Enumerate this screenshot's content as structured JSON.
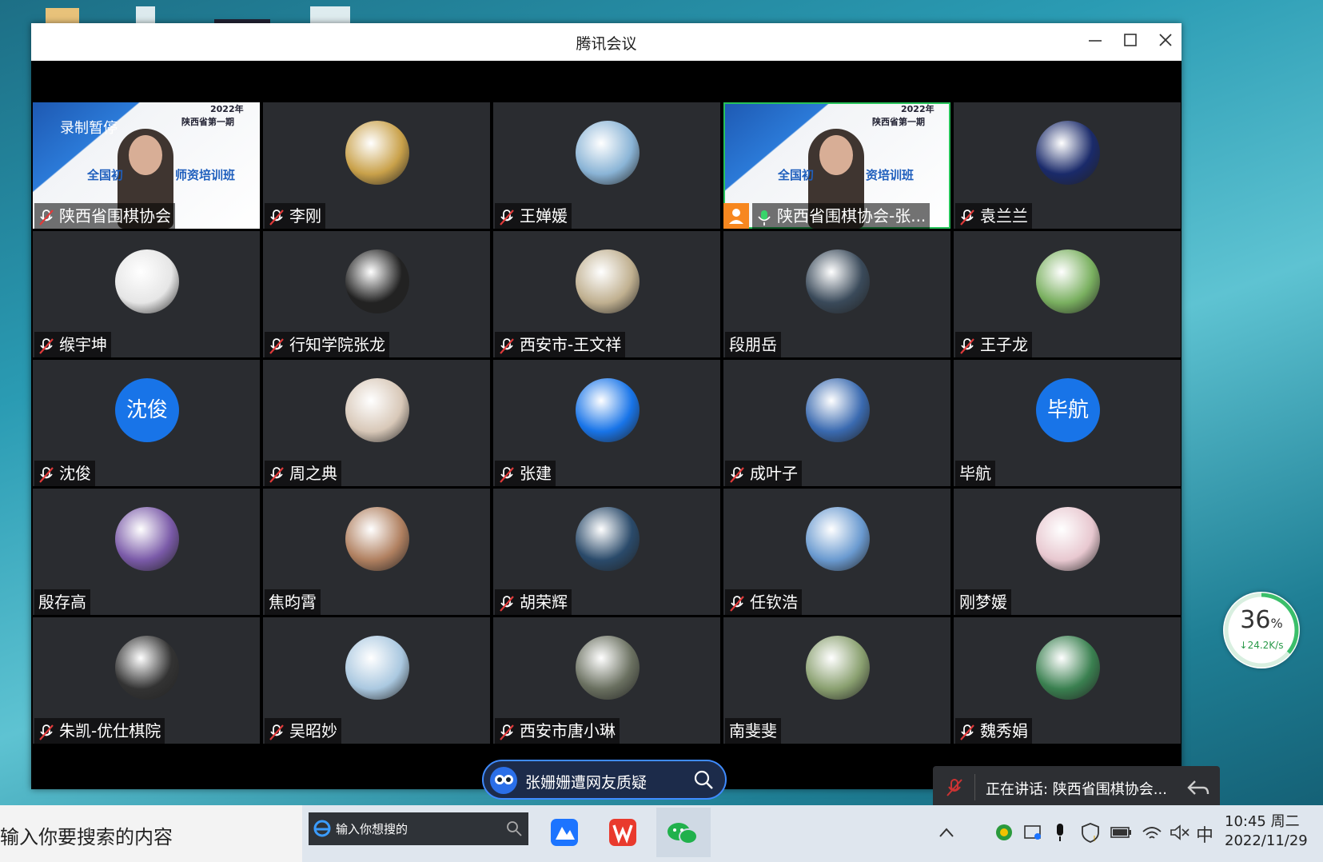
{
  "window": {
    "title": "腾讯会议"
  },
  "participants": [
    {
      "name": "陕西省围棋协会",
      "muted": true,
      "video": true,
      "recording": "录制暂停",
      "banner_year": "2022年",
      "banner_line": "陕西省第一期",
      "banner_title_a": "全国初",
      "banner_title_b": "师资培训班"
    },
    {
      "name": "李刚",
      "muted": true
    },
    {
      "name": "王婵媛",
      "muted": true
    },
    {
      "name": "陕西省围棋协会-张...",
      "muted": false,
      "video": true,
      "host": true,
      "speaking": true,
      "banner_year": "2022年",
      "banner_line": "陕西省第一期",
      "banner_title_a": "全国初",
      "banner_title_b": "资培训班"
    },
    {
      "name": "袁兰兰",
      "muted": true
    },
    {
      "name": "缑宇坤",
      "muted": true
    },
    {
      "name": "行知学院张龙",
      "muted": true
    },
    {
      "name": "西安市-王文祥",
      "muted": true
    },
    {
      "name": "段朋岳",
      "muted": false
    },
    {
      "name": "王子龙",
      "muted": true
    },
    {
      "name": "沈俊",
      "muted": true,
      "avatar_text": "沈俊"
    },
    {
      "name": "周之典",
      "muted": true
    },
    {
      "name": "张建",
      "muted": true
    },
    {
      "name": "成叶子",
      "muted": true
    },
    {
      "name": "毕航",
      "muted": false,
      "avatar_text": "毕航"
    },
    {
      "name": "殷存高",
      "muted": false
    },
    {
      "name": "焦昀霄",
      "muted": false
    },
    {
      "name": "胡荣辉",
      "muted": true
    },
    {
      "name": "任钦浩",
      "muted": true
    },
    {
      "name": "刚梦媛",
      "muted": false
    },
    {
      "name": "朱凯-优仕棋院",
      "muted": true
    },
    {
      "name": "吴昭妙",
      "muted": true
    },
    {
      "name": "西安市唐小琳",
      "muted": true
    },
    {
      "name": "南斐斐",
      "muted": false
    },
    {
      "name": "魏秀娟",
      "muted": true
    }
  ],
  "search_pill": {
    "text": "张姗姗遭网友质疑"
  },
  "speaker_toast": {
    "text": "正在讲话: 陕西省围棋协会..."
  },
  "speed_gauge": {
    "percent": "36",
    "unit": "%",
    "speed": "24.2K/s"
  },
  "taskbar": {
    "search_text": "输入你要搜索的内容",
    "browser_placeholder": "输入你想搜的",
    "ime": "中",
    "time": "10:45 周二",
    "date": "2022/11/29"
  },
  "avatar_colors": [
    "#c9a14a",
    "#8ab4d6",
    "#1a2a6a",
    "#e6e6e6",
    "#222",
    "#c0b090",
    "#3a4a5a",
    "#7ab060",
    "#d8c8b8",
    "#1874e8",
    "#3a6ab0",
    "#7a5aa8",
    "#b08060",
    "#2a4a6a",
    "#6a9ad0",
    "#e8c8d0",
    "#333",
    "#aac8e0",
    "#6a7060",
    "#8aa070",
    "#3a8050"
  ]
}
